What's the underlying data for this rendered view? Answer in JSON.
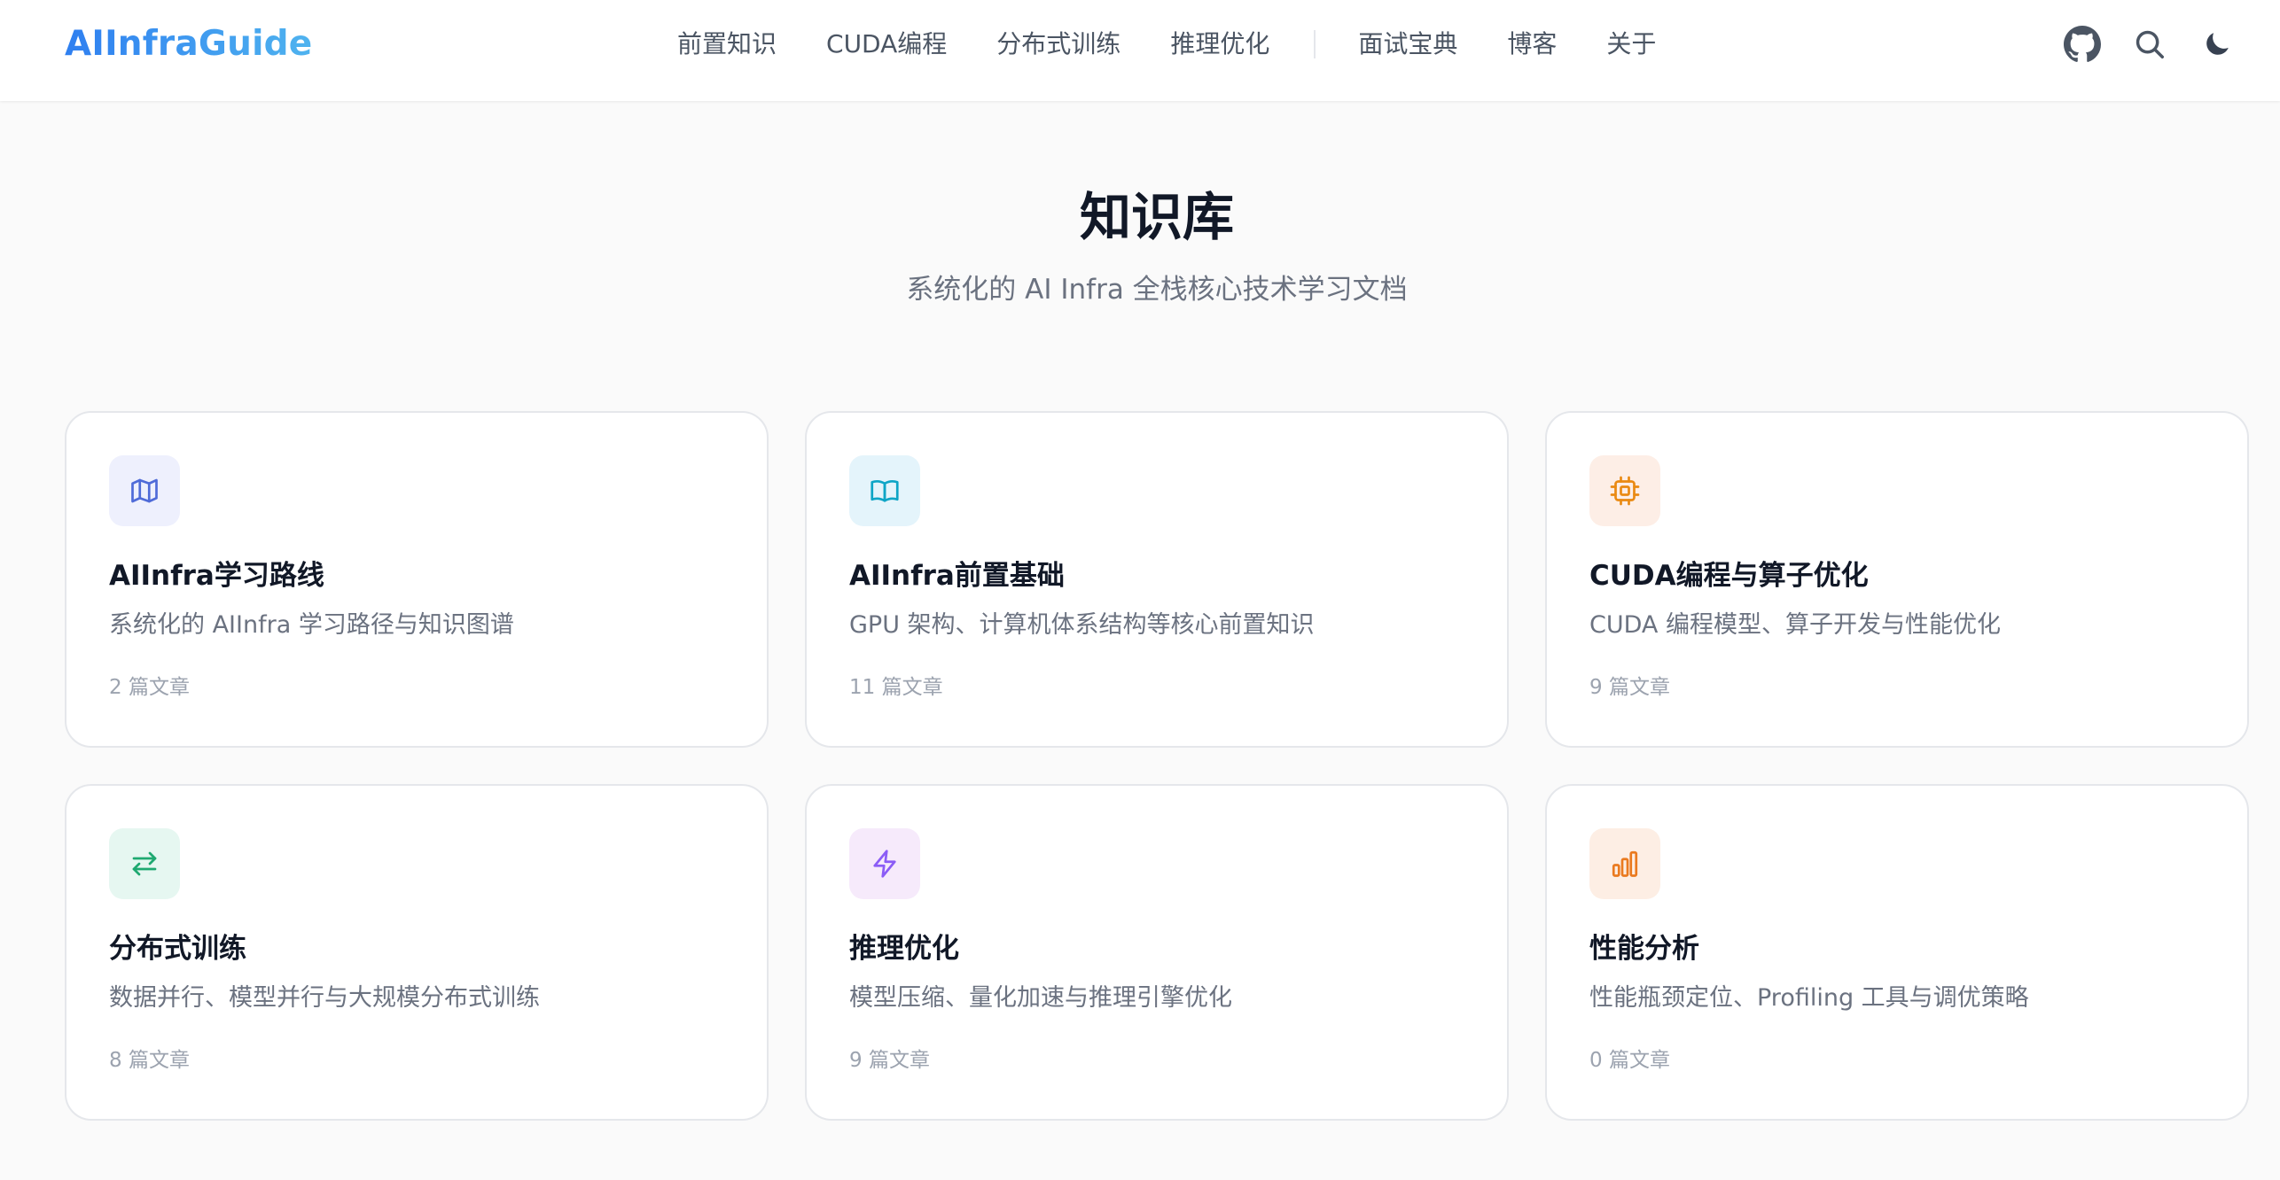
{
  "brand": "AIInfraGuide",
  "nav": {
    "links": [
      "前置知识",
      "CUDA编程",
      "分布式训练",
      "推理优化",
      "面试宝典",
      "博客",
      "关于"
    ],
    "icons": [
      "github-icon",
      "search-icon",
      "moon-icon"
    ]
  },
  "hero": {
    "title": "知识库",
    "subtitle": "系统化的 AI Infra 全栈核心技术学习文档"
  },
  "cards": [
    {
      "title": "AIInfra学习路线",
      "desc": "系统化的 AIInfra 学习路径与知识图谱",
      "count": "2 篇文章",
      "icon": "map-icon",
      "color": "#4f6bd8",
      "bg": "#eef0fd"
    },
    {
      "title": "AIInfra前置基础",
      "desc": "GPU 架构、计算机体系结构等核心前置知识",
      "count": "11 篇文章",
      "icon": "book-open-icon",
      "color": "#0ea5c6",
      "bg": "#e4f4fb"
    },
    {
      "title": "CUDA编程与算子优化",
      "desc": "CUDA 编程模型、算子开发与性能优化",
      "count": "9 篇文章",
      "icon": "cpu-icon",
      "color": "#ea8a13",
      "bg": "#fdeee6"
    },
    {
      "title": "分布式训练",
      "desc": "数据并行、模型并行与大规模分布式训练",
      "count": "8 篇文章",
      "icon": "arrows-exchange-icon",
      "color": "#1fa971",
      "bg": "#e6f7f1"
    },
    {
      "title": "推理优化",
      "desc": "模型压缩、量化加速与推理引擎优化",
      "count": "9 篇文章",
      "icon": "lightning-icon",
      "color": "#8b5cf6",
      "bg": "#f6eafb"
    },
    {
      "title": "性能分析",
      "desc": "性能瓶颈定位、Profiling 工具与调优策略",
      "count": "0 篇文章",
      "icon": "bar-chart-icon",
      "color": "#ea7a1f",
      "bg": "#fdeee4"
    }
  ]
}
